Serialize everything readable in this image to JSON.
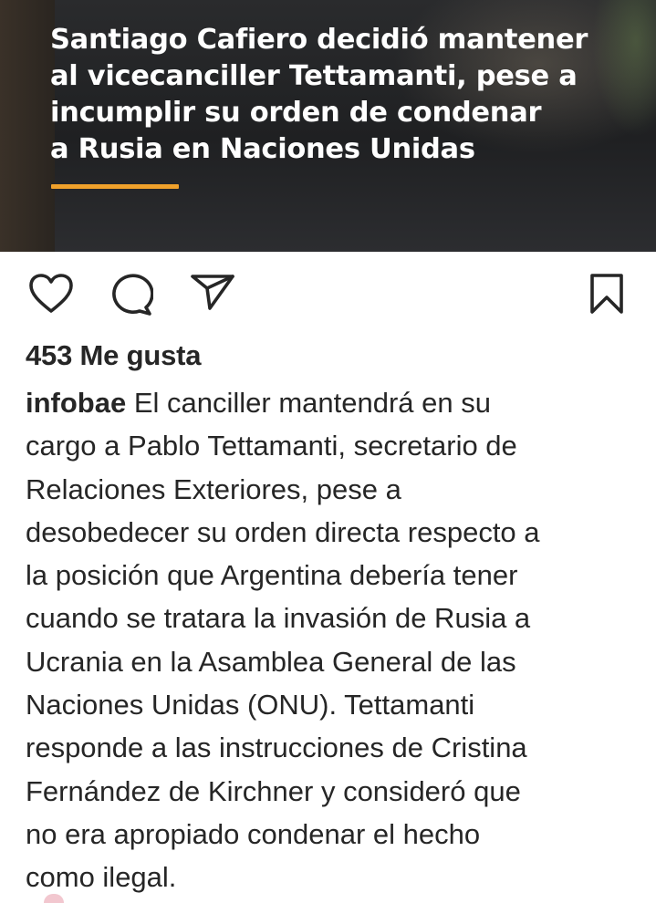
{
  "post_image": {
    "headline_lines": [
      "Santiago Cafiero decidió mantener",
      "al vicecanciller Tettamanti, pese a",
      "incumplir su orden de condenar",
      "a Rusia en Naciones Unidas"
    ],
    "accent_color": "#f0a12b"
  },
  "actions": {
    "like_icon": "heart-icon",
    "comment_icon": "comment-icon",
    "share_icon": "send-icon",
    "save_icon": "bookmark-icon"
  },
  "likes": "453 Me gusta",
  "caption": {
    "username": "infobae",
    "first_line_rest": " El canciller mantendrá en su",
    "lines": [
      "cargo a Pablo Tettamanti, secretario de",
      "Relaciones Exteriores, pese a",
      "desobedecer su orden directa respecto a",
      "la posición que Argentina debería tener",
      "cuando se tratara la invasión de Rusia a",
      "Ucrania en la Asamblea General de las",
      "Naciones Unidas (ONU). Tettamanti",
      "responde a las instrucciones de Cristina",
      "Fernández de Kirchner y consideró que",
      "no era apropiado condenar el hecho",
      "como ilegal."
    ]
  }
}
